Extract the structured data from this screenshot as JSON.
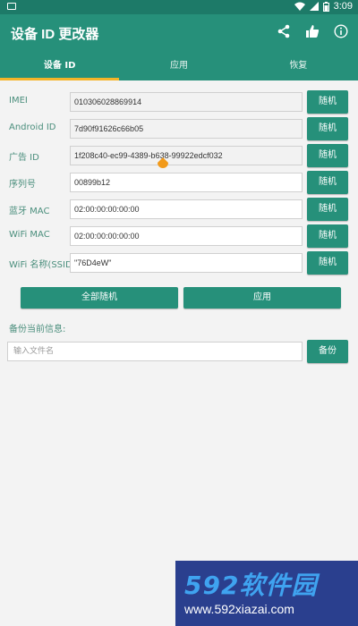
{
  "status": {
    "time": "3:09"
  },
  "appbar": {
    "title": "设备 ID 更改器"
  },
  "tabs": [
    {
      "label": "设备 ID",
      "active": true
    },
    {
      "label": "应用",
      "active": false
    },
    {
      "label": "恢复",
      "active": false
    }
  ],
  "fields": [
    {
      "label": "IMEI",
      "value": "010306028869914",
      "button": "随机"
    },
    {
      "label": "Android ID",
      "value": "7d90f91626c66b05",
      "button": "随机"
    },
    {
      "label": "广告 ID",
      "value": "1f208c40-ec99-4389-b638-99922edcf032",
      "button": "随机"
    },
    {
      "label": "序列号",
      "value": "00899b12",
      "button": "随机"
    },
    {
      "label": "蓝牙 MAC",
      "value": "02:00:00:00:00:00",
      "button": "随机"
    },
    {
      "label": "WiFi MAC",
      "value": "02:00:00:00:00:00",
      "button": "随机"
    },
    {
      "label": "WiFi 名称(SSID)",
      "value": "\"76D4eW\"",
      "button": "随机"
    }
  ],
  "actions": {
    "random_all": "全部随机",
    "apply": "应用"
  },
  "backup": {
    "label": "备份当前信息:",
    "placeholder": "输入文件名",
    "button": "备份"
  },
  "watermark": {
    "brand": "592软件园",
    "url": "www.592xiazai.com"
  },
  "colors": {
    "primary": "#26907a",
    "statusbar": "#1d7a68",
    "tab_indicator": "#f5b428",
    "cursor": "#f29a1a"
  }
}
